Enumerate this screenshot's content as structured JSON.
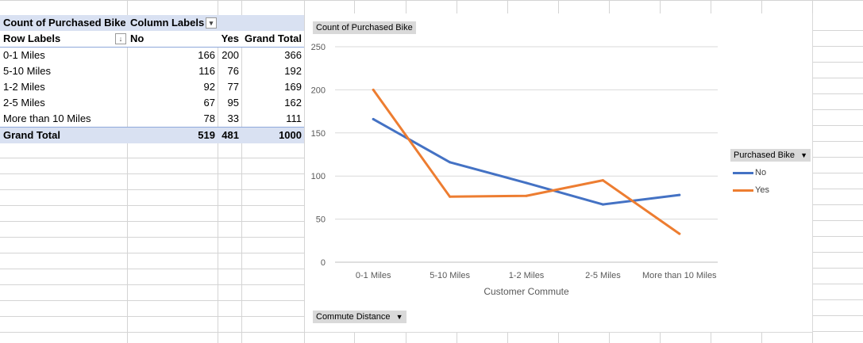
{
  "pivot": {
    "header": {
      "value_field": "Count of Purchased Bike",
      "column_labels": "Column Labels"
    },
    "subheader": {
      "row_labels": "Row Labels",
      "col_no": "No",
      "col_yes": "Yes",
      "col_total": "Grand Total"
    },
    "rows": [
      {
        "label": "0-1 Miles",
        "no": "166",
        "yes": "200",
        "total": "366"
      },
      {
        "label": "5-10 Miles",
        "no": "116",
        "yes": "76",
        "total": "192"
      },
      {
        "label": "1-2 Miles",
        "no": "92",
        "yes": "77",
        "total": "169"
      },
      {
        "label": "2-5 Miles",
        "no": "67",
        "yes": "95",
        "total": "162"
      },
      {
        "label": "More than 10 Miles",
        "no": "78",
        "yes": "33",
        "total": "111"
      }
    ],
    "grand_total": {
      "label": "Grand Total",
      "no": "519",
      "yes": "481",
      "total": "1000"
    }
  },
  "chart_buttons": {
    "value_field": "Count of Purchased Bike",
    "axis_field": "Commute Distance",
    "legend_field": "Purchased Bike"
  },
  "colors": {
    "No": "#4472c4",
    "Yes": "#ed7d31"
  },
  "chart_data": {
    "type": "line",
    "categories": [
      "0-1 Miles",
      "5-10 Miles",
      "1-2 Miles",
      "2-5 Miles",
      "More than 10 Miles"
    ],
    "series": [
      {
        "name": "No",
        "values": [
          166,
          116,
          92,
          67,
          78
        ]
      },
      {
        "name": "Yes",
        "values": [
          200,
          76,
          77,
          95,
          33
        ]
      }
    ],
    "title": "",
    "xlabel": "Customer Commute",
    "ylabel": "",
    "ylim": [
      0,
      250
    ],
    "yticks": [
      0,
      50,
      100,
      150,
      200,
      250
    ],
    "grid": true,
    "legend": "right"
  }
}
